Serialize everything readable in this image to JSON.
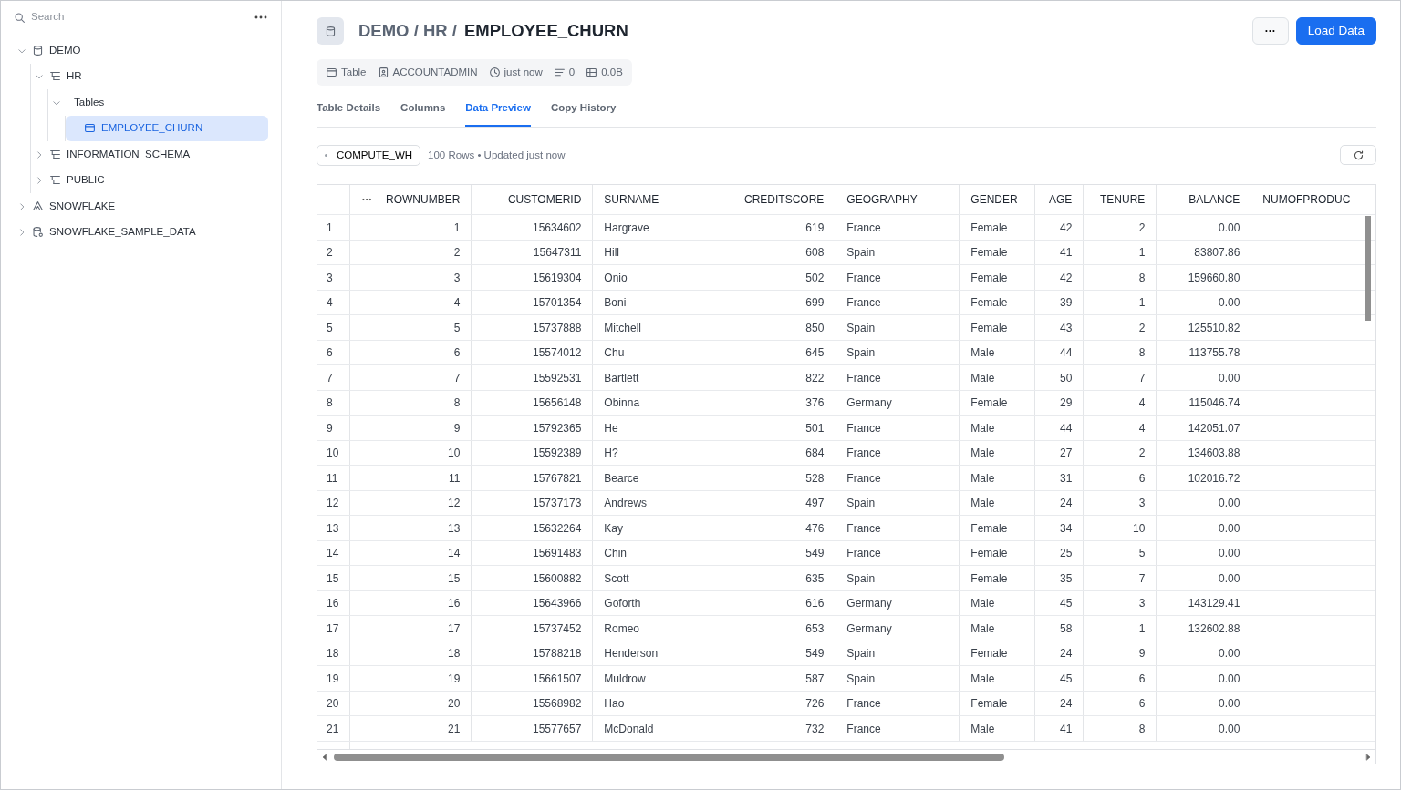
{
  "sidebar": {
    "search": {
      "placeholder": "Search"
    },
    "tree": [
      {
        "label": "DEMO",
        "kind": "database",
        "expanded": true,
        "selected": false,
        "children": [
          {
            "label": "HR",
            "kind": "schema",
            "expanded": true,
            "selected": false,
            "children": [
              {
                "label": "Tables",
                "expanded": true,
                "selected": false,
                "children": [
                  {
                    "label": "EMPLOYEE_CHURN",
                    "kind": "table",
                    "selected": true
                  }
                ]
              }
            ]
          },
          {
            "label": "INFORMATION_SCHEMA",
            "kind": "schema",
            "expanded": false,
            "selected": false
          },
          {
            "label": "PUBLIC",
            "kind": "schema",
            "expanded": false,
            "selected": false
          }
        ]
      },
      {
        "label": "SNOWFLAKE",
        "kind": "app",
        "expanded": false,
        "selected": false
      },
      {
        "label": "SNOWFLAKE_SAMPLE_DATA",
        "kind": "shared",
        "expanded": false,
        "selected": false
      }
    ]
  },
  "header": {
    "path": "DEMO / HR /",
    "name": "EMPLOYEE_CHURN",
    "actions": {
      "more": "···",
      "primary": "Load Data"
    }
  },
  "meta": [
    {
      "kind": "table",
      "text": "Table"
    },
    {
      "kind": "owner",
      "text": "ACCOUNTADMIN"
    },
    {
      "kind": "time",
      "text": "just now"
    },
    {
      "kind": "rows",
      "text": "0"
    },
    {
      "kind": "size",
      "text": "0.0B"
    }
  ],
  "tabs": [
    {
      "label": "Table Details",
      "selected": false
    },
    {
      "label": "Columns",
      "selected": false
    },
    {
      "label": "Data Preview",
      "selected": true
    },
    {
      "label": "Copy History",
      "selected": false
    }
  ],
  "toolbar": {
    "warehouse": "COMPUTE_WH",
    "summary": "100 Rows • Updated just now"
  },
  "table": {
    "columns": [
      "",
      "ROWNUMBER",
      "CUSTOMERID",
      "SURNAME",
      "CREDITSCORE",
      "GEOGRAPHY",
      "GENDER",
      "AGE",
      "TENURE",
      "BALANCE",
      "NUMOFPRODUC"
    ],
    "rows": [
      [
        "1",
        "1",
        "15634602",
        "Hargrave",
        "619",
        "France",
        "Female",
        "42",
        "2",
        "0.00"
      ],
      [
        "2",
        "2",
        "15647311",
        "Hill",
        "608",
        "Spain",
        "Female",
        "41",
        "1",
        "83807.86"
      ],
      [
        "3",
        "3",
        "15619304",
        "Onio",
        "502",
        "France",
        "Female",
        "42",
        "8",
        "159660.80"
      ],
      [
        "4",
        "4",
        "15701354",
        "Boni",
        "699",
        "France",
        "Female",
        "39",
        "1",
        "0.00"
      ],
      [
        "5",
        "5",
        "15737888",
        "Mitchell",
        "850",
        "Spain",
        "Female",
        "43",
        "2",
        "125510.82"
      ],
      [
        "6",
        "6",
        "15574012",
        "Chu",
        "645",
        "Spain",
        "Male",
        "44",
        "8",
        "113755.78"
      ],
      [
        "7",
        "7",
        "15592531",
        "Bartlett",
        "822",
        "France",
        "Male",
        "50",
        "7",
        "0.00"
      ],
      [
        "8",
        "8",
        "15656148",
        "Obinna",
        "376",
        "Germany",
        "Female",
        "29",
        "4",
        "115046.74"
      ],
      [
        "9",
        "9",
        "15792365",
        "He",
        "501",
        "France",
        "Male",
        "44",
        "4",
        "142051.07"
      ],
      [
        "10",
        "10",
        "15592389",
        "H?",
        "684",
        "France",
        "Male",
        "27",
        "2",
        "134603.88"
      ],
      [
        "11",
        "11",
        "15767821",
        "Bearce",
        "528",
        "France",
        "Male",
        "31",
        "6",
        "102016.72"
      ],
      [
        "12",
        "12",
        "15737173",
        "Andrews",
        "497",
        "Spain",
        "Male",
        "24",
        "3",
        "0.00"
      ],
      [
        "13",
        "13",
        "15632264",
        "Kay",
        "476",
        "France",
        "Female",
        "34",
        "10",
        "0.00"
      ],
      [
        "14",
        "14",
        "15691483",
        "Chin",
        "549",
        "France",
        "Female",
        "25",
        "5",
        "0.00"
      ],
      [
        "15",
        "15",
        "15600882",
        "Scott",
        "635",
        "Spain",
        "Female",
        "35",
        "7",
        "0.00"
      ],
      [
        "16",
        "16",
        "15643966",
        "Goforth",
        "616",
        "Germany",
        "Male",
        "45",
        "3",
        "143129.41"
      ],
      [
        "17",
        "17",
        "15737452",
        "Romeo",
        "653",
        "Germany",
        "Male",
        "58",
        "1",
        "132602.88"
      ],
      [
        "18",
        "18",
        "15788218",
        "Henderson",
        "549",
        "Spain",
        "Female",
        "24",
        "9",
        "0.00"
      ],
      [
        "19",
        "19",
        "15661507",
        "Muldrow",
        "587",
        "Spain",
        "Male",
        "45",
        "6",
        "0.00"
      ],
      [
        "20",
        "20",
        "15568982",
        "Hao",
        "726",
        "France",
        "Female",
        "24",
        "6",
        "0.00"
      ],
      [
        "21",
        "21",
        "15577657",
        "McDonald",
        "732",
        "France",
        "Male",
        "41",
        "8",
        "0.00"
      ]
    ]
  }
}
